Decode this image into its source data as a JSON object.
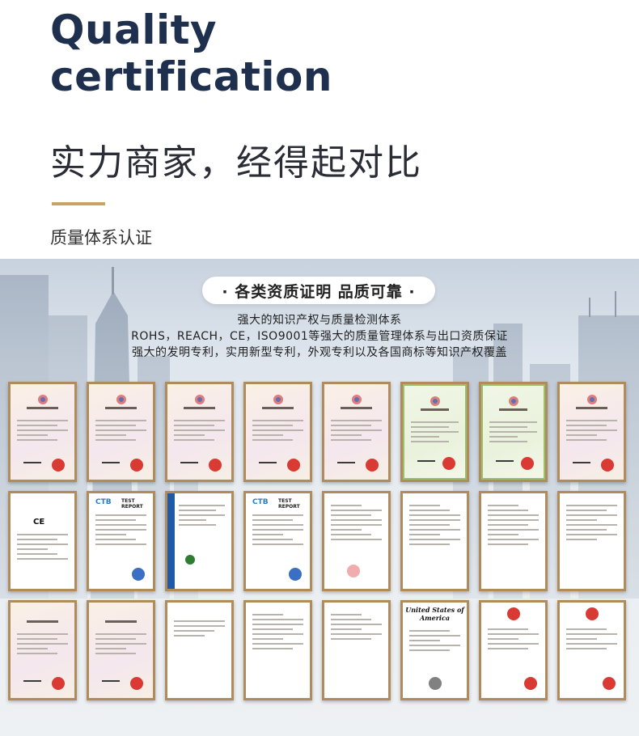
{
  "header": {
    "title_en_line1": "Quality",
    "title_en_line2": "certification",
    "title_cn": "实力商家，经得起对比",
    "subtitle": "质量体系认证"
  },
  "showcase": {
    "banner": "· 各类资质证明 品质可靠 ·",
    "desc": [
      "强大的知识产权与质量检测体系",
      "ROHS，REACH，CE，ISO9001等强大的质量管理体系与出口资质保证",
      "强大的发明专利，实用新型专利，外观专利以及各国商标等知识产权覆盖"
    ],
    "texts": {
      "ctb": "CTB",
      "test_report": "TEST REPORT",
      "ce": "CE",
      "united_states": "United States of America"
    }
  },
  "colors": {
    "title": "#1f2f4e",
    "accent": "#c9a361",
    "frame": "#b08c5d",
    "seal": "#d93a34"
  }
}
